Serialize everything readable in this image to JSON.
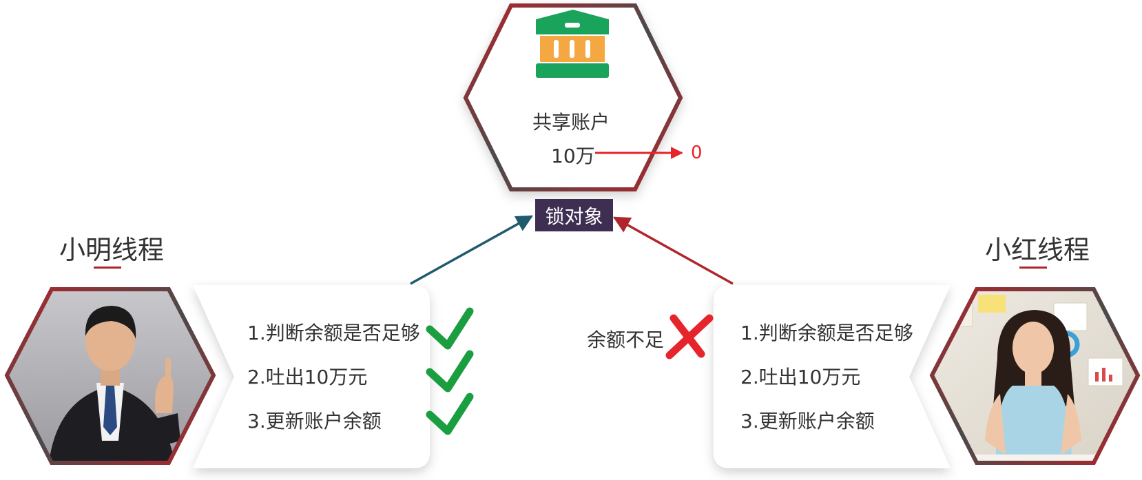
{
  "colors": {
    "red": "#b0252b",
    "red_bright": "#e5242b",
    "dark_gray": "#4a4a4a",
    "teal_arrow": "#1f5a6e",
    "lock_bg": "#3d2e52",
    "check_green": "#1a9e3f",
    "bank_green": "#1aa35a",
    "bank_orange": "#f5a742"
  },
  "bank": {
    "icon": "bank-icon",
    "title": "共享账户",
    "balance_before": "10万",
    "balance_after": "0"
  },
  "lock": {
    "label": "锁对象"
  },
  "threads": [
    {
      "id": "xiaoming",
      "name": "小明线程",
      "avatar": "man-in-suit-photo",
      "steps": [
        "1.判断余额是否足够",
        "2.吐出10万元",
        "3.更新账户余额"
      ],
      "step_status": [
        "check",
        "check",
        "check"
      ]
    },
    {
      "id": "xiaohong",
      "name": "小红线程",
      "avatar": "woman-in-office-photo",
      "steps": [
        "1.判断余额是否足够",
        "2.吐出10万元",
        "3.更新账户余额"
      ],
      "failure_note": "余额不足"
    }
  ]
}
